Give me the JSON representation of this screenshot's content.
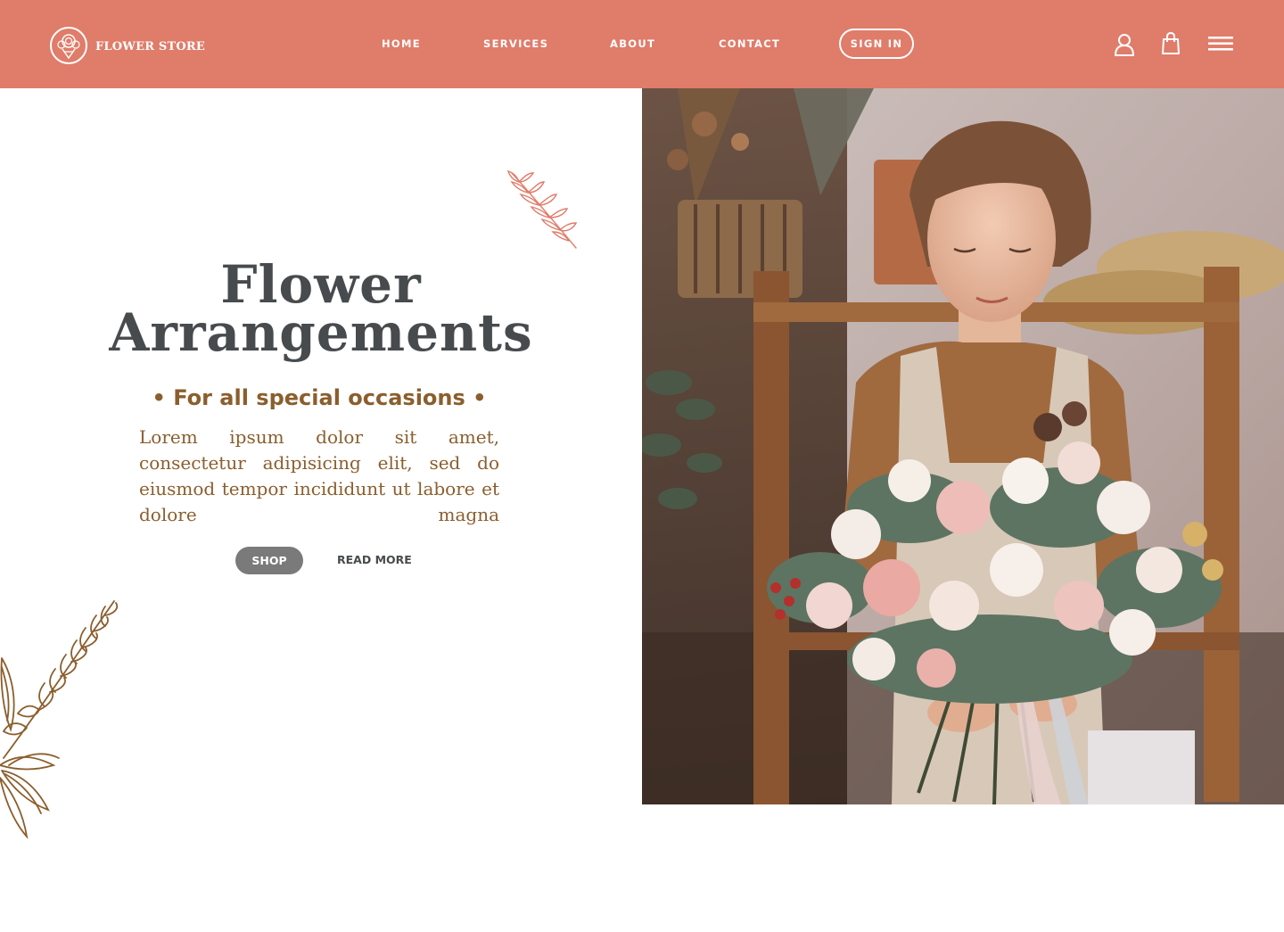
{
  "brand": {
    "name": "FLOWER STORE",
    "logo_icon": "flower-logo-icon"
  },
  "nav": {
    "home": "HOME",
    "services": "SERVICES",
    "about": "ABOUT",
    "contact": "CONTACT",
    "sign_in": "SIGN IN"
  },
  "header_icons": [
    "user-icon",
    "shopping-bag-icon",
    "menu-icon"
  ],
  "hero": {
    "title_line1": "Flower",
    "title_line2": "Arrangements",
    "subtitle": "• For all special occasions •",
    "body": "Lorem ipsum dolor sit amet, consectetur adipisicing elit, sed do eiusmod tempor incididunt ut labore et dolore magna",
    "shop_label": "SHOP",
    "read_more_label": "READ MORE"
  },
  "colors": {
    "header_bg": "#e07c6a",
    "title": "#474b4d",
    "accent_brown": "#8b5e2d",
    "shop_button": "#7a7a7a"
  }
}
